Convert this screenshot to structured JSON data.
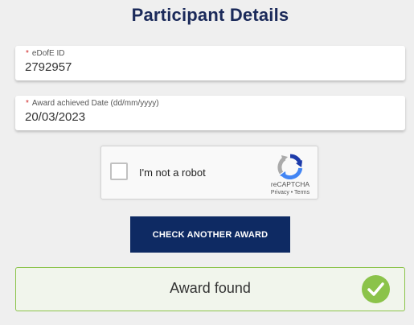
{
  "page": {
    "title": "Participant Details"
  },
  "form": {
    "edofe_id": {
      "required_mark": "*",
      "label": "eDofE ID",
      "value": "2792957"
    },
    "award_date": {
      "required_mark": "*",
      "label": "Award achieved Date (dd/mm/yyyy)",
      "value": "20/03/2023"
    }
  },
  "recaptcha": {
    "checkbox_label": "I'm not a robot",
    "brand": "reCAPTCHA",
    "links": "Privacy - Terms",
    "checked": false,
    "icon": "recaptcha-logo"
  },
  "actions": {
    "check_another_label": "CHECK ANOTHER AWARD"
  },
  "result": {
    "message": "Award found",
    "icon": "check-circle-icon",
    "status_color": "#8bc34a"
  },
  "colors": {
    "brand_navy": "#0e2a63",
    "title": "#1b2a5a",
    "required": "#d02626"
  }
}
